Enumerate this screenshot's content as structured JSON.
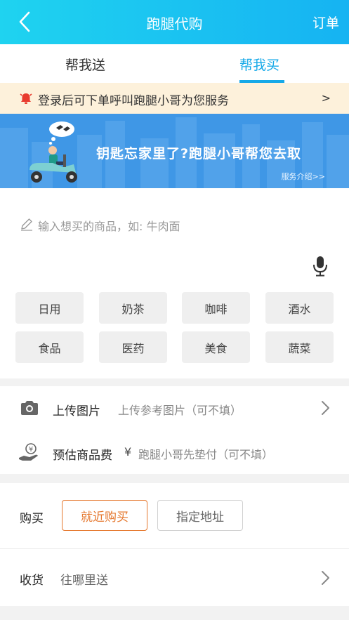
{
  "header": {
    "title": "跑腿代购",
    "orders_label": "订单"
  },
  "tabs": [
    {
      "label": "帮我送"
    },
    {
      "label": "帮我买"
    }
  ],
  "notice": {
    "text": "登录后可下单呼叫跑腿小哥为您服务",
    "arrow": ">"
  },
  "banner": {
    "headline": "钥匙忘家里了?跑腿小哥帮您去取",
    "link": "服务介绍>>"
  },
  "item_input": {
    "placeholder": "输入想买的商品，如: 牛肉面"
  },
  "categories": [
    "日用",
    "奶茶",
    "咖啡",
    "酒水",
    "食品",
    "医药",
    "美食",
    "蔬菜"
  ],
  "upload": {
    "label": "上传图片",
    "hint": "上传参考图片（可不填）"
  },
  "fee": {
    "label": "预估商品费",
    "currency": "¥",
    "hint": "跑腿小哥先垫付（可不填）"
  },
  "buy": {
    "label": "购买",
    "options": [
      "就近购买",
      "指定地址"
    ],
    "selected": "就近购买"
  },
  "receive": {
    "label": "收货",
    "placeholder": "往哪里送"
  },
  "colors": {
    "header_start": "#1fd3f0",
    "header_end": "#16b3f2",
    "accent": "#16a9e8",
    "selected_option": "#e5772d",
    "notice_bg": "#fdf1db",
    "banner_bg": "#3f97e6"
  }
}
